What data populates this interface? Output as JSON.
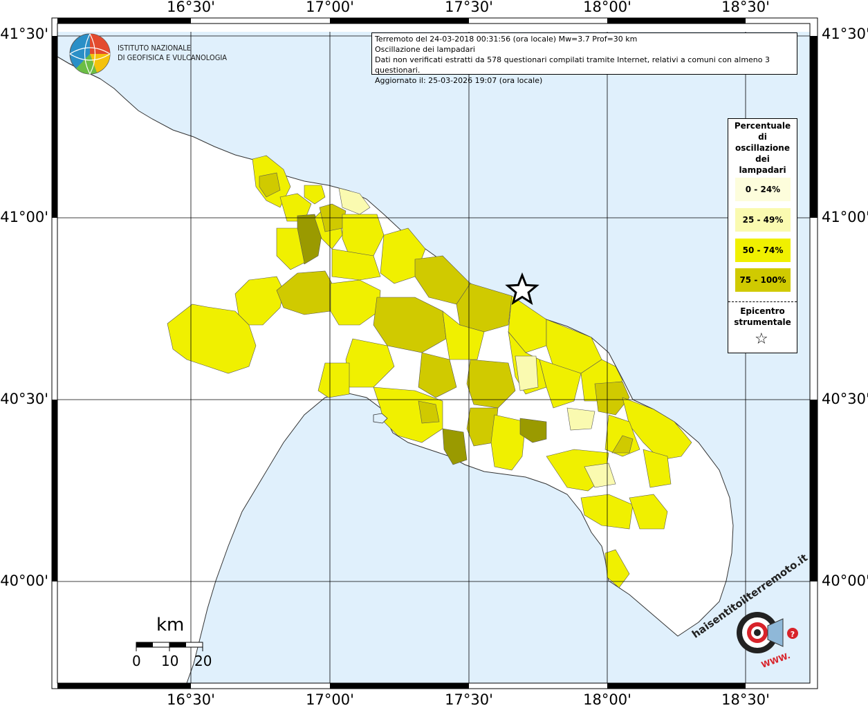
{
  "axis_labels": {
    "longitudes": [
      "16°30'",
      "17°00'",
      "17°30'",
      "18°00'",
      "18°30'"
    ],
    "latitudes": [
      "41°30'",
      "41°00'",
      "40°30'",
      "40°00'"
    ]
  },
  "logo": {
    "line1": "ISTITUTO NAZIONALE",
    "line2": "DI GEOFISICA E VULCANOLOGIA"
  },
  "info": {
    "line1": "Terremoto del 24-03-2018 00:31:56 (ora locale) Mw=3.7 Prof=30 km",
    "line2": "Oscillazione dei lampadari",
    "line3": "Dati non verificati estratti da 578 questionari compilati tramite Internet, relativi a comuni con almeno 3 questionari.",
    "line4": "Aggiornato il: 25-03-2026 19:07 (ora locale)"
  },
  "legend": {
    "title_lines": [
      "Percentuale",
      "di",
      "oscillazione",
      "dei",
      "lampadari"
    ],
    "classes": [
      {
        "label": "0 - 24%",
        "color": "#fdfddc"
      },
      {
        "label": "25 - 49%",
        "color": "#fafab0"
      },
      {
        "label": "50 - 74%",
        "color": "#f0f000"
      },
      {
        "label": "75 - 100%",
        "color": "#d0ca00"
      }
    ],
    "epicenter_title_lines": [
      "Epicentro",
      "strumentale"
    ],
    "epicenter_symbol": "☆"
  },
  "scale_bar": {
    "unit": "km",
    "ticks": [
      "0",
      "10",
      "20"
    ]
  },
  "colors": {
    "sea": "#e0f0fc",
    "land": "#ffffff",
    "class_0_24": "#fdfddc",
    "class_25_49": "#fafab0",
    "class_50_74": "#f0f000",
    "class_75_100": "#d0ca00",
    "class_dark": "#9a9a00"
  },
  "watermark": {
    "text": "haisentitoilterremoto.it",
    "url_text": "WWW."
  }
}
